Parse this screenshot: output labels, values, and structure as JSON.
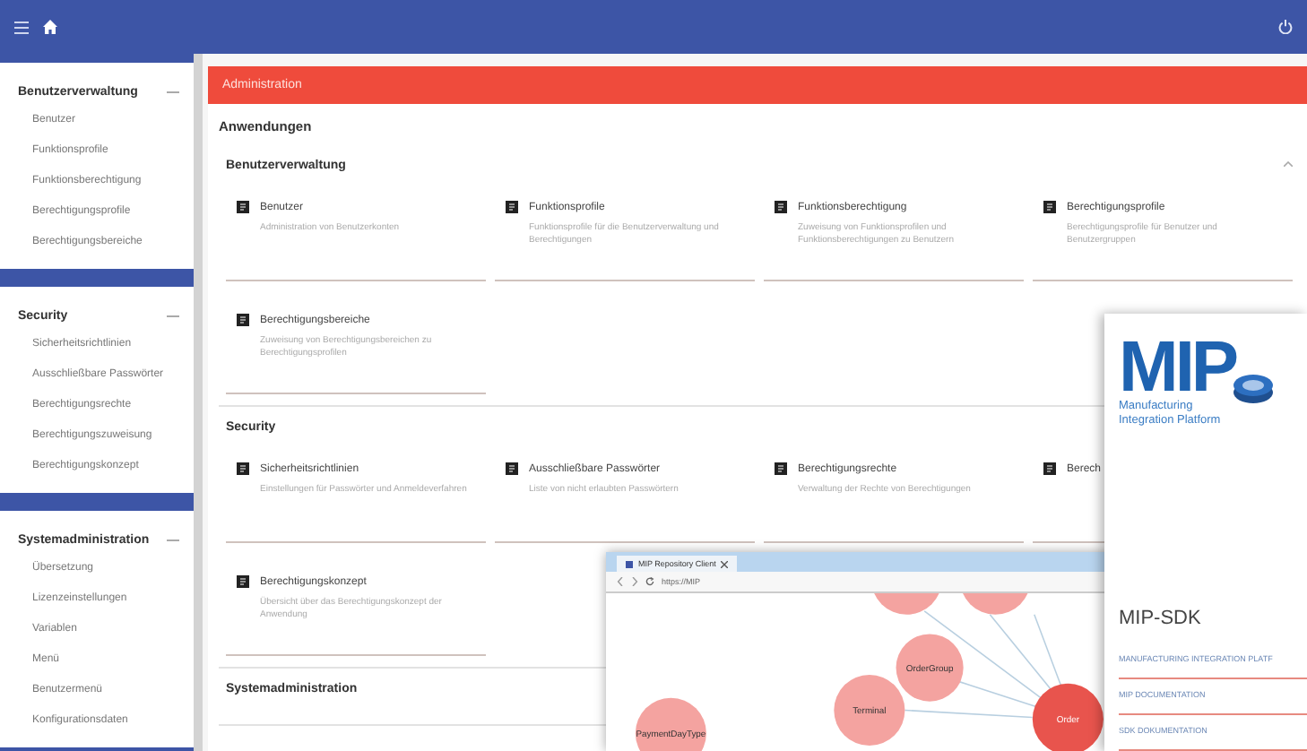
{
  "sidebar": {
    "sections": [
      {
        "title": "Benutzerverwaltung",
        "items": [
          "Benutzer",
          "Funktionsprofile",
          "Funktionsberechtigung",
          "Berechtigungsprofile",
          "Berechtigungsbereiche"
        ]
      },
      {
        "title": "Security",
        "items": [
          "Sicherheitsrichtlinien",
          "Ausschließbare Passwörter",
          "Berechtigungsrechte",
          "Berechtigungszuweisung",
          "Berechtigungskonzept"
        ]
      },
      {
        "title": "Systemadministration",
        "items": [
          "Übersetzung",
          "Lizenzeinstellungen",
          "Variablen",
          "Menü",
          "Benutzermenü",
          "Konfigurationsdaten"
        ]
      }
    ]
  },
  "page_header": "Administration",
  "heading": "Anwendungen",
  "groups": [
    {
      "title": "Benutzerverwaltung",
      "tiles": [
        {
          "title": "Benutzer",
          "description": "Administration von Benutzerkonten"
        },
        {
          "title": "Funktionsprofile",
          "description": "Funktionsprofile für die Benutzerverwaltung und Berechtigungen"
        },
        {
          "title": "Funktionsberechtigung",
          "description": "Zuweisung von Funktionsprofilen und Funktionsberechtigungen zu Benutzern"
        },
        {
          "title": "Berechtigungsprofile",
          "description": "Berechtigungsprofile für Benutzer und Benutzergruppen"
        },
        {
          "title": "Berechtigungsbereiche",
          "description": "Zuweisung von Berechtigungsbereichen zu Berechtigungsprofilen"
        }
      ]
    },
    {
      "title": "Security",
      "tiles": [
        {
          "title": "Sicherheitsrichtlinien",
          "description": "Einstellungen für Passwörter und Anmeldeverfahren"
        },
        {
          "title": "Ausschließbare Passwörter",
          "description": "Liste von nicht erlaubten Passwörtern"
        },
        {
          "title": "Berechtigungsrechte",
          "description": "Verwaltung der Rechte von Berechtigungen"
        },
        {
          "title": "Berech"
        },
        {
          "title": "Berechtigungskonzept",
          "description": "Übersicht über das Berechtigungskonzept der Anwendung"
        }
      ]
    },
    {
      "title": "Systemadministration"
    }
  ],
  "browser": {
    "tab": "MIP Repository Client",
    "address": "https://MIP",
    "nodes": [
      {
        "label": "OrderGroup",
        "selected": false
      },
      {
        "label": "Terminal",
        "selected": false
      },
      {
        "label": "Order",
        "selected": true
      },
      {
        "label": "PaymentDayType",
        "selected": false
      }
    ]
  },
  "mip_panel": {
    "logo": "MIP",
    "tagline": [
      "Manufacturing",
      "Integration Platform"
    ],
    "title": "MIP-SDK",
    "links": [
      "MANUFACTURING INTEGRATION PLATF",
      "MIP DOCUMENTATION",
      "SDK DOKUMENTATION"
    ]
  }
}
